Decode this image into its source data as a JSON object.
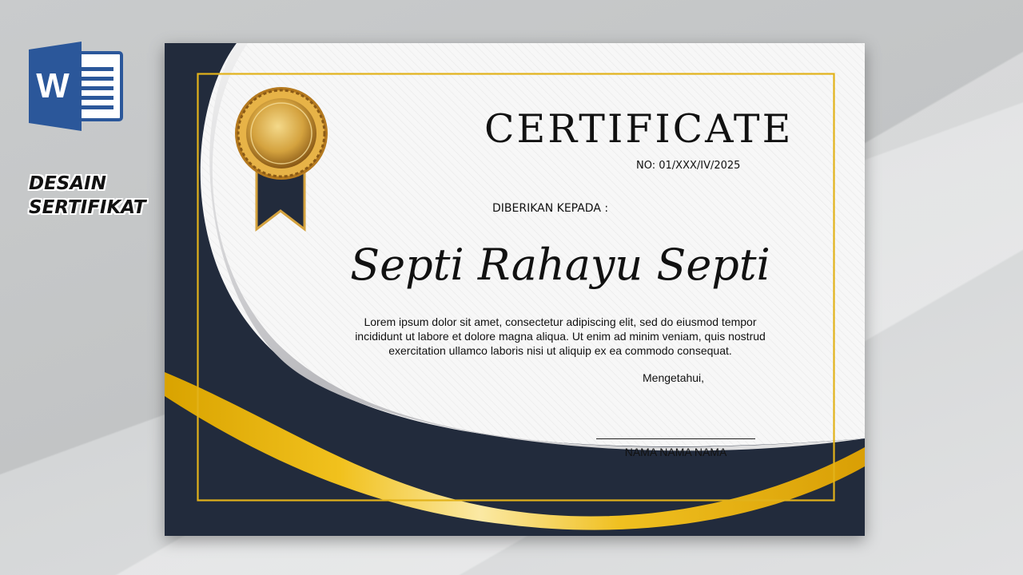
{
  "thumbnail": {
    "app_icon": "microsoft-word-icon",
    "app_icon_letter": "W",
    "side_title_line1": "DESAIN",
    "side_title_line2": "SERTIFIKAT"
  },
  "certificate": {
    "title": "CERTIFICATE",
    "number": "NO: 01/XXX/IV/2025",
    "given_to_label": "DIBERIKAN KEPADA :",
    "recipient_name": "Septi Rahayu Septi",
    "body_text": "Lorem ipsum dolor sit amet, consectetur adipiscing elit, sed do eiusmod tempor incididunt ut labore et dolore magna aliqua. Ut enim ad minim veniam, quis nostrud exercitation ullamco laboris nisi ut aliquip ex ea commodo consequat.",
    "acknowledge_label": "Mengetahui,",
    "signer_name": "NAMA NAMA NAMA",
    "badge_icon": "gold-medal-ribbon-icon"
  },
  "colors": {
    "navy": "#222b3c",
    "gold": "#e8b40f",
    "word_blue": "#2b579a",
    "border_gold": "#e2b21a"
  }
}
